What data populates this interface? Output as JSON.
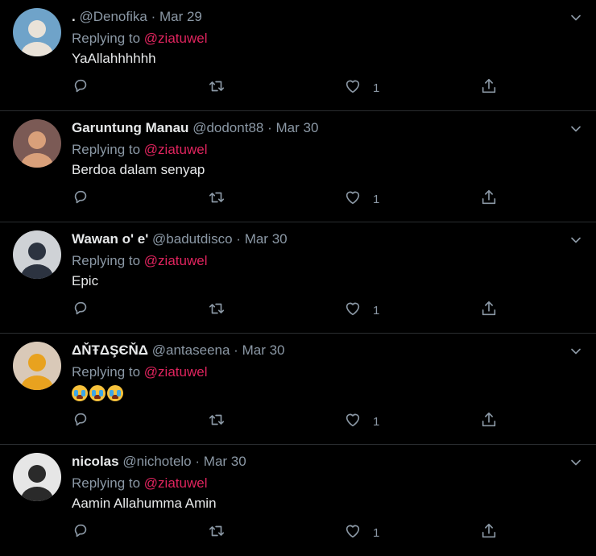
{
  "replying_label": "Replying to",
  "tweets": [
    {
      "name": ".",
      "handle": "@Denofika",
      "date": "Mar 29",
      "reply_to": "@ziatuwel",
      "text": "YaAllahhhhhh",
      "likes": "1",
      "avatar": {
        "bg": "#6fa3c9",
        "fg": "#e9e2d8"
      }
    },
    {
      "name": "Garuntung Manau",
      "handle": "@dodont88",
      "date": "Mar 30",
      "reply_to": "@ziatuwel",
      "text": "Berdoa dalam senyap",
      "likes": "1",
      "avatar": {
        "bg": "#7b5a55",
        "fg": "#d9a07a"
      }
    },
    {
      "name": "Wawan o' e'",
      "handle": "@badutdisco",
      "date": "Mar 30",
      "reply_to": "@ziatuwel",
      "text": "Epic",
      "likes": "1",
      "avatar": {
        "bg": "#cfd2d6",
        "fg": "#2c3340"
      }
    },
    {
      "name": "ΔŇŦΔŞЄŇΔ",
      "handle": "@antaseena",
      "date": "Mar 30",
      "reply_to": "@ziatuwel",
      "text": "",
      "emoji_count": 3,
      "likes": "1",
      "avatar": {
        "bg": "#d9c9b8",
        "fg": "#e8a21f"
      }
    },
    {
      "name": "nicolas",
      "handle": "@nichotelo",
      "date": "Mar 30",
      "reply_to": "@ziatuwel",
      "text": "Aamin Allahumma Amin",
      "likes": "1",
      "avatar": {
        "bg": "#e6e6e6",
        "fg": "#2a2a2a"
      }
    }
  ],
  "icons": {
    "reply": "reply-icon",
    "retweet": "retweet-icon",
    "like": "heart-icon",
    "share": "share-icon",
    "more": "chevron-down-icon"
  },
  "colors": {
    "background": "#000000",
    "mention": "#e0245e",
    "muted": "#8b98a5",
    "divider": "#2a2d30"
  }
}
